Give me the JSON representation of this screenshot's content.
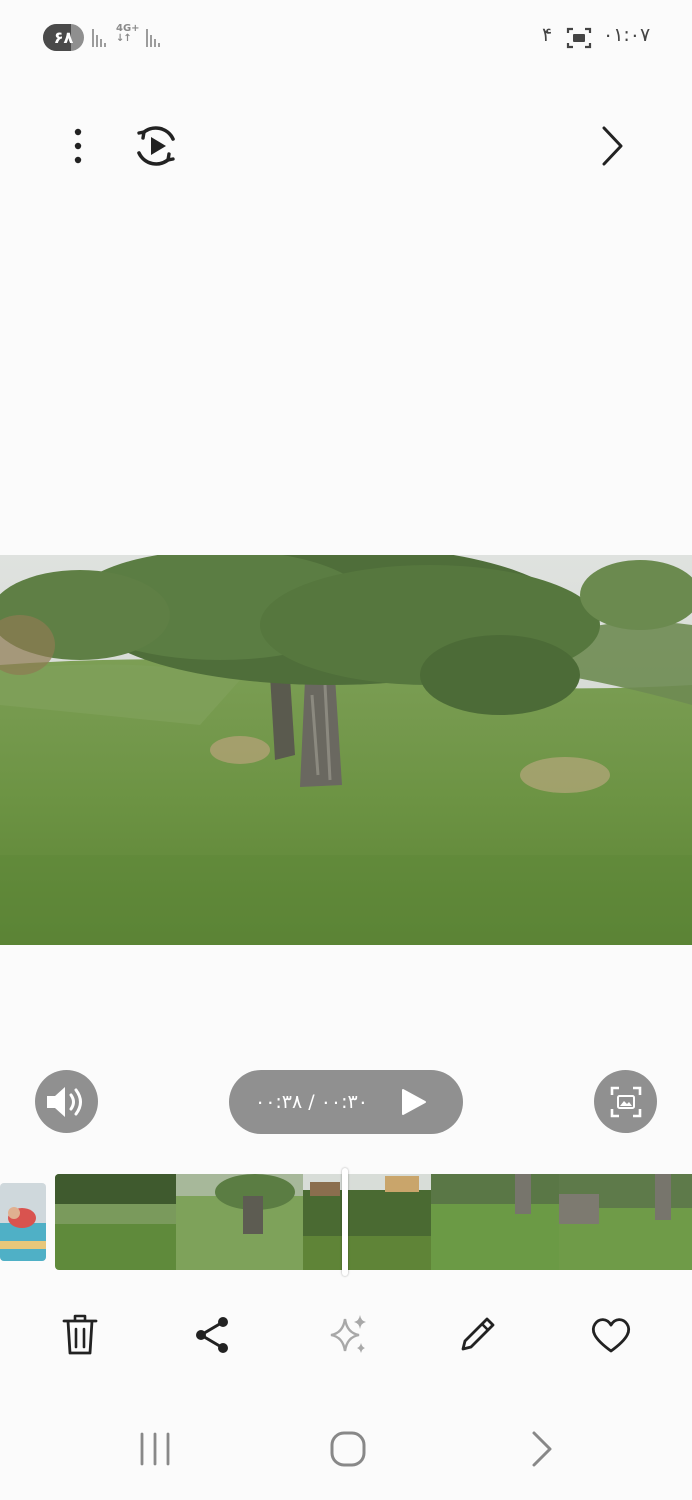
{
  "status_bar": {
    "battery_level": "۶۸",
    "battery_fraction": 0.68,
    "network_type": "4G+",
    "notification_count": "۴",
    "time": "۰۱:۰۷",
    "icons": [
      "signal-icon",
      "signal-icon",
      "screenshot-icon"
    ]
  },
  "toolbar": {
    "icons": [
      "more-options-icon",
      "motion-photo-icon",
      "next-icon"
    ]
  },
  "video": {
    "time_display": "۰۰:۳۸ / ۰۰:۳۰",
    "icons": [
      "volume-icon",
      "play-icon",
      "capture-frame-icon"
    ]
  },
  "bottom_actions": {
    "icons": [
      "trash-icon",
      "share-icon",
      "sparkle-icon",
      "edit-icon",
      "heart-icon"
    ]
  },
  "nav_bar": {
    "icons": [
      "recents-icon",
      "home-icon",
      "back-icon"
    ]
  },
  "colors": {
    "background": "#fbfbfb",
    "control_gray": "#909090",
    "icon_dark": "#222222"
  }
}
